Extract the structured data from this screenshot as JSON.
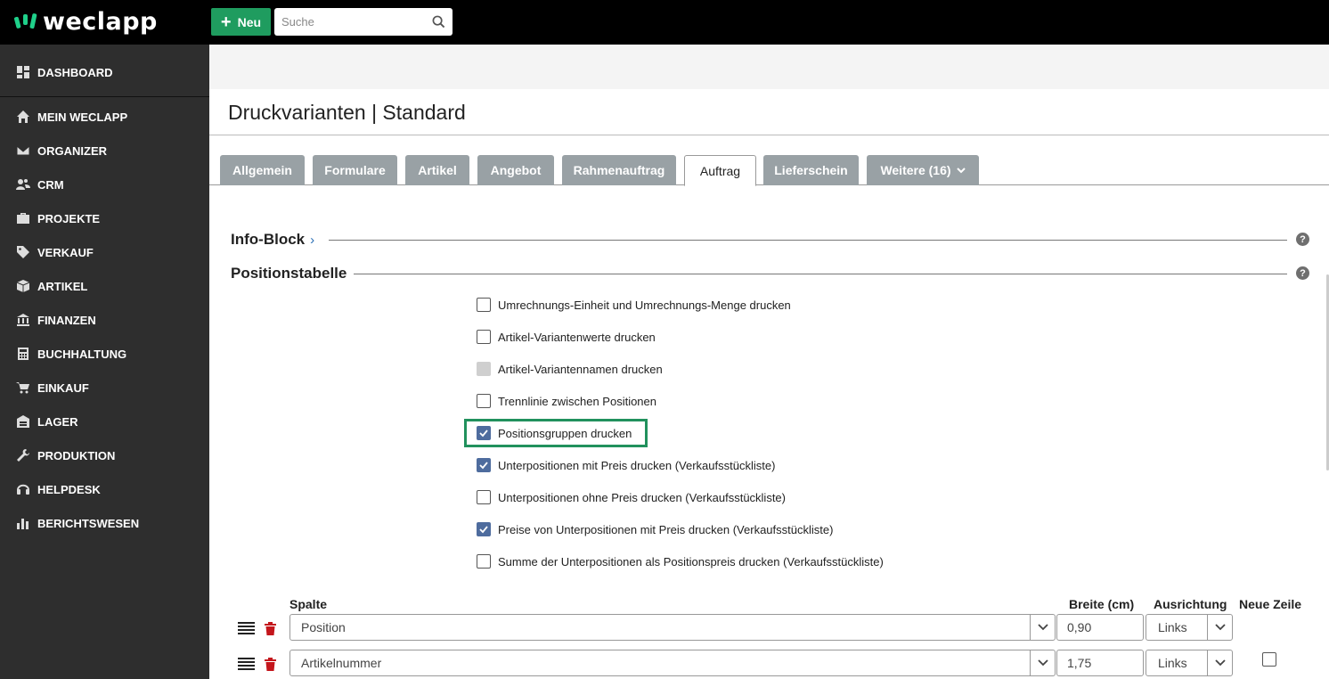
{
  "brand": {
    "name": "weclapp",
    "accent": "#1f9c5f"
  },
  "topbar": {
    "new_label": "Neu",
    "search_placeholder": "Suche"
  },
  "sidebar": {
    "items": [
      {
        "label": "DASHBOARD",
        "icon": "dashboard-icon"
      },
      {
        "label": "MEIN WECLAPP",
        "icon": "home-icon"
      },
      {
        "label": "ORGANIZER",
        "icon": "envelope-icon"
      },
      {
        "label": "CRM",
        "icon": "users-icon"
      },
      {
        "label": "PROJEKTE",
        "icon": "briefcase-icon"
      },
      {
        "label": "VERKAUF",
        "icon": "tag-icon"
      },
      {
        "label": "ARTIKEL",
        "icon": "box-icon"
      },
      {
        "label": "FINANZEN",
        "icon": "bank-icon"
      },
      {
        "label": "BUCHHALTUNG",
        "icon": "calculator-icon"
      },
      {
        "label": "EINKAUF",
        "icon": "cart-icon"
      },
      {
        "label": "LAGER",
        "icon": "warehouse-icon"
      },
      {
        "label": "PRODUKTION",
        "icon": "wrench-icon"
      },
      {
        "label": "HELPDESK",
        "icon": "headset-icon"
      },
      {
        "label": "BERICHTSWESEN",
        "icon": "bar-chart-icon"
      }
    ]
  },
  "page": {
    "title": "Druckvarianten | Standard"
  },
  "tabs": [
    {
      "label": "Allgemein",
      "active": false
    },
    {
      "label": "Formulare",
      "active": false
    },
    {
      "label": "Artikel",
      "active": false
    },
    {
      "label": "Angebot",
      "active": false
    },
    {
      "label": "Rahmenauftrag",
      "active": false
    },
    {
      "label": "Auftrag",
      "active": true
    },
    {
      "label": "Lieferschein",
      "active": false
    },
    {
      "label": "Weitere (16)",
      "active": false
    }
  ],
  "sections": {
    "info_block": "Info-Block",
    "positionstabelle": "Positionstabelle"
  },
  "options": [
    {
      "label": "Umrechnungs-Einheit und Umrechnungs-Menge drucken",
      "state": "unchecked"
    },
    {
      "label": "Artikel-Variantenwerte drucken",
      "state": "unchecked"
    },
    {
      "label": "Artikel-Variantennamen drucken",
      "state": "disabled"
    },
    {
      "label": "Trennlinie zwischen Positionen",
      "state": "unchecked"
    },
    {
      "label": "Positionsgruppen drucken",
      "state": "checked"
    },
    {
      "label": "Unterpositionen mit Preis drucken (Verkaufsstückliste)",
      "state": "checked"
    },
    {
      "label": "Unterpositionen ohne Preis drucken (Verkaufsstückliste)",
      "state": "unchecked"
    },
    {
      "label": "Preise von Unterpositionen mit Preis drucken (Verkaufsstückliste)",
      "state": "checked"
    },
    {
      "label": "Summe der Unterpositionen als Positionspreis drucken (Verkaufsstückliste)",
      "state": "unchecked"
    }
  ],
  "columns_table": {
    "headers": {
      "spalte": "Spalte",
      "breite": "Breite (cm)",
      "ausrichtung": "Ausrichtung",
      "neue_zeile": "Neue Zeile"
    },
    "rows": [
      {
        "spalte": "Position",
        "breite": "0,90",
        "ausrichtung": "Links",
        "neue_zeile": null
      },
      {
        "spalte": "Artikelnummer",
        "breite": "1,75",
        "ausrichtung": "Links",
        "neue_zeile": false
      }
    ]
  }
}
